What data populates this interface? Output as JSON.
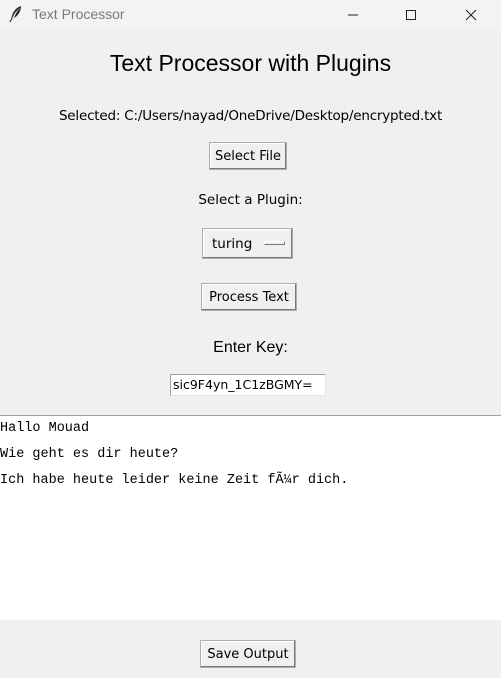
{
  "window": {
    "title": "Text Processor",
    "app_icon": "feather-icon",
    "controls": [
      "minimize-icon",
      "maximize-icon",
      "close-icon"
    ]
  },
  "main": {
    "heading": "Text Processor with Plugins",
    "selected_file": "Selected: C:/Users/nayad/OneDrive/Desktop/encrypted.txt",
    "select_file_label": "Select File",
    "plugin_label": "Select a Plugin:",
    "plugin_value": "turing",
    "process_label": "Process Text",
    "key_label": "Enter Key:",
    "key_value": "sic9F4yn_1C1zBGMY="
  },
  "output": {
    "lines": [
      "Hallo Mouad",
      "Wie geht es dir heute?",
      "Ich habe heute leider keine Zeit fÃ¼r dich."
    ]
  },
  "footer": {
    "save_label": "Save Output"
  }
}
